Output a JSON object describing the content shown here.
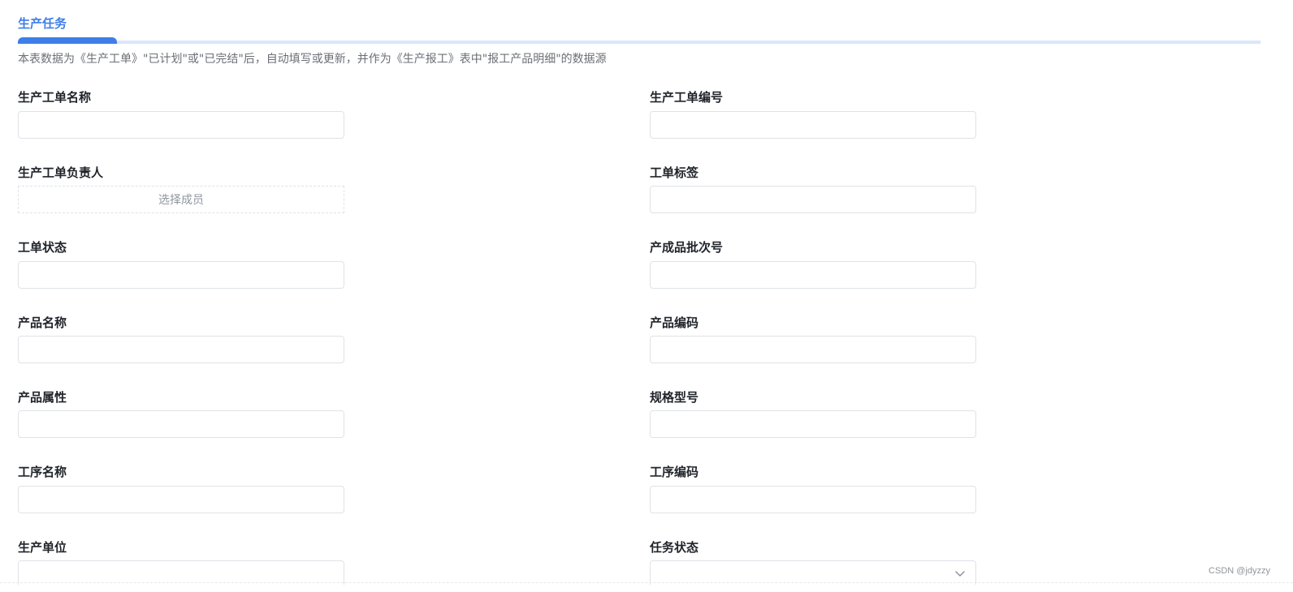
{
  "section": {
    "title": "生产任务",
    "description": "本表数据为《生产工单》\"已计划\"或\"已完结\"后，自动填写或更新，并作为《生产报工》表中\"报工产品明细\"的数据源"
  },
  "fields": {
    "work_order_name": {
      "label": "生产工单名称",
      "value": ""
    },
    "work_order_number": {
      "label": "生产工单编号",
      "value": ""
    },
    "work_order_owner": {
      "label": "生产工单负责人",
      "placeholder": "选择成员"
    },
    "work_order_tag": {
      "label": "工单标签",
      "value": ""
    },
    "work_order_status": {
      "label": "工单状态",
      "value": ""
    },
    "batch_number": {
      "label": "产成品批次号",
      "value": ""
    },
    "product_name": {
      "label": "产品名称",
      "value": ""
    },
    "product_code": {
      "label": "产品编码",
      "value": ""
    },
    "product_attribute": {
      "label": "产品属性",
      "value": ""
    },
    "spec_model": {
      "label": "规格型号",
      "value": ""
    },
    "process_name": {
      "label": "工序名称",
      "value": ""
    },
    "process_code": {
      "label": "工序编码",
      "value": ""
    },
    "production_unit": {
      "label": "生产单位",
      "value": ""
    },
    "task_status": {
      "label": "任务状态",
      "value": ""
    }
  },
  "icons": {
    "task_status_dropdown": "chevron-down-icon"
  },
  "colors": {
    "accent": "#3d7ee8",
    "accent_light": "#d9e7fb",
    "label": "#1f2329",
    "muted": "#6b6f76",
    "border": "#dfe2e6"
  },
  "watermark": "CSDN @jdyzzy"
}
